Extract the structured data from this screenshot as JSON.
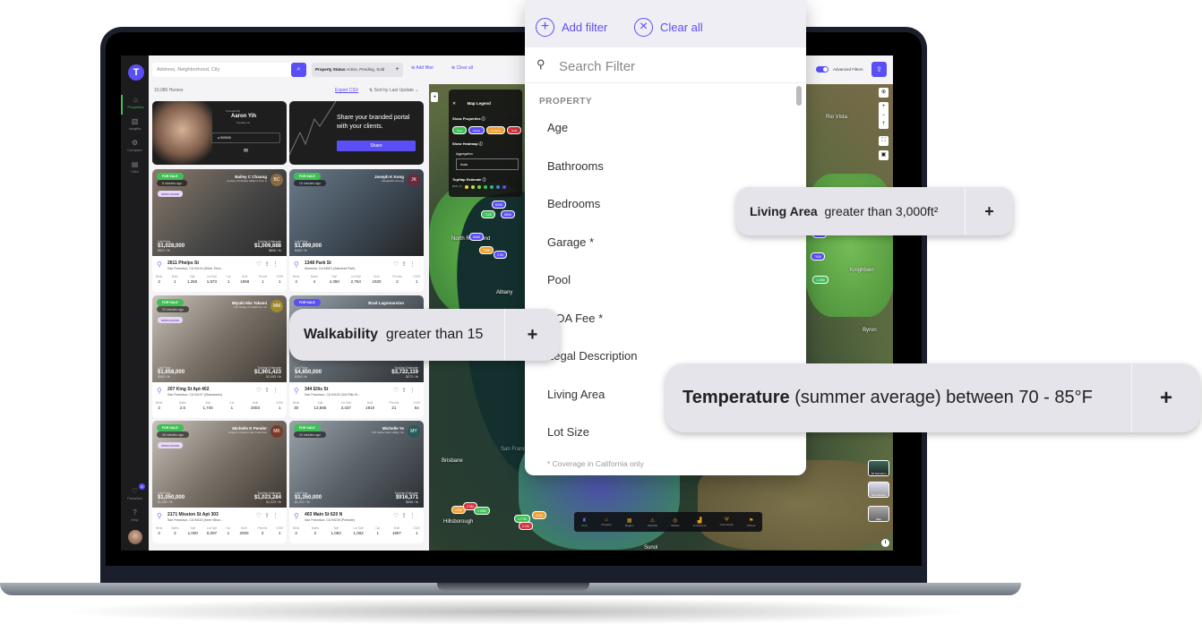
{
  "sidebar": {
    "logo": "T",
    "items": [
      {
        "label": "Properties",
        "icon": "home-icon",
        "glyph": "⌂"
      },
      {
        "label": "Insights",
        "icon": "chart-icon",
        "glyph": "▥"
      },
      {
        "label": "Compare",
        "icon": "compare-icon",
        "glyph": "⚙"
      },
      {
        "label": "CMA",
        "icon": "document-icon",
        "glyph": "▤"
      }
    ],
    "bottom": [
      {
        "label": "Favorites",
        "icon": "heart-icon",
        "glyph": "♡",
        "badge": "8"
      },
      {
        "label": "Help",
        "icon": "help-icon",
        "glyph": "?"
      }
    ]
  },
  "topbar": {
    "search_placeholder": "Address, Neighborhood, City",
    "search_glyph": "⌕",
    "status_label": "Property Status",
    "status_value": "Active, Pending, Sold",
    "status_plus": "+",
    "add_filter": "⊕ Add filter",
    "clear_all": "⊗ Clear all",
    "advanced_filters": "Advanced Filters",
    "advanced_enabled": true,
    "share_glyph": "⇪"
  },
  "list": {
    "count": "10,085 Homes",
    "export": "Export CSV",
    "sort": "⇅ Sort by Last Update ⌄",
    "agent_card": {
      "provided_by": "Provided By",
      "name": "Aaron Yih",
      "company": "TopHap Inc.",
      "phone": "909000",
      "mail_glyph": "✉"
    },
    "promo": {
      "text": "Share your branded portal with your clients.",
      "button": "Share"
    },
    "listings": [
      {
        "status": "FOR SALE",
        "ago": "6 minutes ago",
        "open_house": "OPEN HOUSE",
        "agent": "Bailey C Chaung",
        "office": "Century 21 Realty Alliance Fine H",
        "initials": "BC",
        "list_label": "List Price",
        "price": "$1,028,000",
        "price_sqft": "$822 / ft²",
        "est_label": "TopHap Estimate",
        "estimate": "$1,009,688",
        "est_sqft": "$808 / ft²",
        "address": "2611 Phelps St",
        "city": "San Francisco, CA 94124 (Silver Terra...",
        "stats": [
          [
            "Beds",
            "2"
          ],
          [
            "Bath",
            "1"
          ],
          [
            "Sqft",
            "1,250"
          ],
          [
            "Lot Sqft",
            "1,873"
          ],
          [
            "Car",
            "1"
          ],
          [
            "Built",
            "1958"
          ],
          [
            "Permit",
            "1"
          ],
          [
            "DOM",
            "1"
          ]
        ]
      },
      {
        "status": "FOR SALE",
        "ago": "10 minutes ago",
        "open_house": "",
        "agent": "Joseph K Kong",
        "office": "Asiapacific Groups",
        "initials": "JK",
        "list_label": "List Price",
        "price": "$1,999,000",
        "price_sqft": "$460 / ft²",
        "est_label": "",
        "estimate": "",
        "est_sqft": "",
        "address": "1348 Park St",
        "city": "Alameda, CA 94501 (Alameda Park)",
        "stats": [
          [
            "Beds",
            "4"
          ],
          [
            "Baths",
            "4"
          ],
          [
            "Sqft",
            "4,350"
          ],
          [
            "Lot Sqft",
            "2,763"
          ],
          [
            "Built",
            "1920"
          ],
          [
            "Permits",
            "2"
          ],
          [
            "DOM",
            "1"
          ]
        ]
      },
      {
        "status": "FOR SALE",
        "ago": "22 minutes ago",
        "open_house": "OPEN HOUSE",
        "agent": "Miyuki Mia Takami",
        "office": "eXp Realty of California, Inc",
        "initials": "MM",
        "list_label": "List Price",
        "price": "$1,658,000",
        "price_sqft": "$953 / ft²",
        "est_label": "TopHap Estimate",
        "estimate": "$1,901,423",
        "est_sqft": "$1,093 / ft²",
        "address": "207 King St Apt 402",
        "city": "San Francisco, CA 94107 (Glassworks)",
        "stats": [
          [
            "Beds",
            "2"
          ],
          [
            "Baths",
            "2.5"
          ],
          [
            "Sqft",
            "1,740"
          ],
          [
            "Car",
            "1"
          ],
          [
            "Built",
            "2003"
          ],
          [
            "DOM",
            "1"
          ]
        ]
      },
      {
        "status": "FOR SALE",
        "ago": "",
        "open_house": "",
        "agent": "Brad Lagomarsino",
        "office": "",
        "initials": "",
        "list_label": "List Price",
        "price": "$4,850,000",
        "price_sqft": "$354 / ft²",
        "est_label": "TopHap Estimate",
        "estimate": "$3,722,119",
        "est_sqft": "$272 / ft²",
        "address": "344 Ellis St",
        "city": "San Francisco, CA 94102 (344 Ellis St...",
        "stats": [
          [
            "Beds",
            "30"
          ],
          [
            "Sqft",
            "13,685"
          ],
          [
            "Lot Sqft",
            "3,437"
          ],
          [
            "Built",
            "1910"
          ],
          [
            "Permits",
            "21"
          ],
          [
            "DOM",
            "54"
          ]
        ]
      },
      {
        "status": "FOR SALE",
        "ago": "40 minutes ago",
        "open_house": "OPEN HOUSE",
        "agent": "Michelle K Pender",
        "office": "Engel & Voelkers San Francisco",
        "initials": "MK",
        "list_label": "List Price",
        "price": "$1,050,000",
        "price_sqft": "$1,050 / ft²",
        "est_label": "TopHap Estimate",
        "estimate": "$1,023,284",
        "est_sqft": "$1,023 / ft²",
        "address": "2171 Mission St Apt 303",
        "city": "San Francisco, CA 94110 (Inner Missi...",
        "stats": [
          [
            "Beds",
            "2"
          ],
          [
            "Baths",
            "2"
          ],
          [
            "Sqft",
            "1,000"
          ],
          [
            "Lot Sqft",
            "5,097"
          ],
          [
            "Car",
            "1"
          ],
          [
            "Built",
            "2000"
          ],
          [
            "Permits",
            "3"
          ],
          [
            "DOM",
            "1"
          ]
        ]
      },
      {
        "status": "FOR SALE",
        "ago": "41 minutes ago",
        "open_house": "",
        "agent": "Michelle Ye",
        "office": "KW Santa Clara Valley, Inc",
        "initials": "MY",
        "list_label": "List Price",
        "price": "$1,350,000",
        "price_sqft": "$1,247 / ft²",
        "est_label": "TopHap Estimate",
        "estimate": "$916,371",
        "est_sqft": "$846 / ft²",
        "address": "403 Main St 620 N",
        "city": "San Francisco, CA 94105 (Portside)",
        "stats": [
          [
            "Beds",
            "2"
          ],
          [
            "Baths",
            "2"
          ],
          [
            "Sqft",
            "1,083"
          ],
          [
            "Lot Sqft",
            "1,083"
          ],
          [
            "Car",
            "1"
          ],
          [
            "Built",
            "1997"
          ],
          [
            "DOM",
            "1"
          ]
        ]
      }
    ]
  },
  "map": {
    "legend": {
      "title": "Map Legend",
      "close": "✕",
      "show_properties": "Show Properties ⓘ",
      "pills": [
        {
          "label": "New",
          "color": "#3fbf56"
        },
        {
          "label": "Active",
          "color": "#5a4ff5"
        },
        {
          "label": "Pending",
          "color": "#f0a030"
        },
        {
          "label": "Sold",
          "color": "#d0343c"
        }
      ],
      "show_heatmap": "Show Heatmap ⓘ",
      "aggregation_label": "Aggregation",
      "aggregation_value": "Auto",
      "estimate_label": "TopHap Estimate ⓘ",
      "scale_min": "$561.7k",
      "scale_colors": [
        "#f2d24a",
        "#c8e04a",
        "#7ad15a",
        "#3fbf56",
        "#3ab0a0",
        "#3a8ad0",
        "#5a4ff5"
      ]
    },
    "place_labels": [
      "North Richmond",
      "Albany",
      "San Francisco Bay",
      "Brisbane",
      "Hillsborough",
      "Rio Vista",
      "Knightsen",
      "Byron",
      "Sunol"
    ],
    "price_pills": [
      {
        "label": "549K",
        "type": "b"
      },
      {
        "label": "712K",
        "type": "g"
      },
      {
        "label": "689K",
        "type": "b"
      },
      {
        "label": "606K",
        "type": "b"
      },
      {
        "label": "700K",
        "type": "o"
      },
      {
        "label": "2.5K",
        "type": "b"
      },
      {
        "label": "820.5K",
        "type": "g"
      },
      {
        "label": "749K",
        "type": "b"
      },
      {
        "label": "750K",
        "type": "b"
      },
      {
        "label": "1.15M",
        "type": "g"
      },
      {
        "label": "3.6M",
        "type": "o"
      },
      {
        "label": "2.3M",
        "type": "r"
      },
      {
        "label": "1.95M",
        "type": "g"
      },
      {
        "label": "1.77M",
        "type": "g"
      },
      {
        "label": "2.1M",
        "type": "r"
      },
      {
        "label": "2.2M",
        "type": "o"
      },
      {
        "label": "1.4M",
        "type": "b"
      }
    ],
    "controls": [
      "⊕",
      "+",
      "−",
      "⇡",
      "⛶",
      "▣"
    ],
    "layers": [
      "3D Elevation",
      "Boundaries",
      "Map"
    ],
    "bottom_nav": [
      {
        "label": "Value",
        "glyph": "♜",
        "active": true
      },
      {
        "label": "Property",
        "glyph": "⌂"
      },
      {
        "label": "Region",
        "glyph": "▦"
      },
      {
        "label": "Hazards",
        "glyph": "⚠"
      },
      {
        "label": "Market",
        "glyph": "◎"
      },
      {
        "label": "Investment",
        "glyph": "▟"
      },
      {
        "label": "Community",
        "glyph": "Ψ"
      },
      {
        "label": "School",
        "glyph": "⚑"
      }
    ],
    "info": "i"
  },
  "filter_dropdown": {
    "add_filter": "Add filter",
    "clear_all": "Clear all",
    "search_placeholder": "Search Filter",
    "section": "PROPERTY",
    "items": [
      "Age",
      "Bathrooms",
      "Bedrooms",
      "Garage *",
      "Pool",
      "HOA Fee *",
      "Legal Description",
      "Living Area",
      "Lot Size"
    ],
    "note": "* Coverage in California only"
  },
  "chips": [
    {
      "name": "Living Area",
      "condition": "greater than 3,000ft²",
      "plus": "+"
    },
    {
      "name": "Walkability",
      "condition": "greater than 15",
      "plus": "+"
    },
    {
      "name": "Temperature",
      "condition": "(summer average) between 70 - 85°F",
      "plus": "+"
    }
  ]
}
